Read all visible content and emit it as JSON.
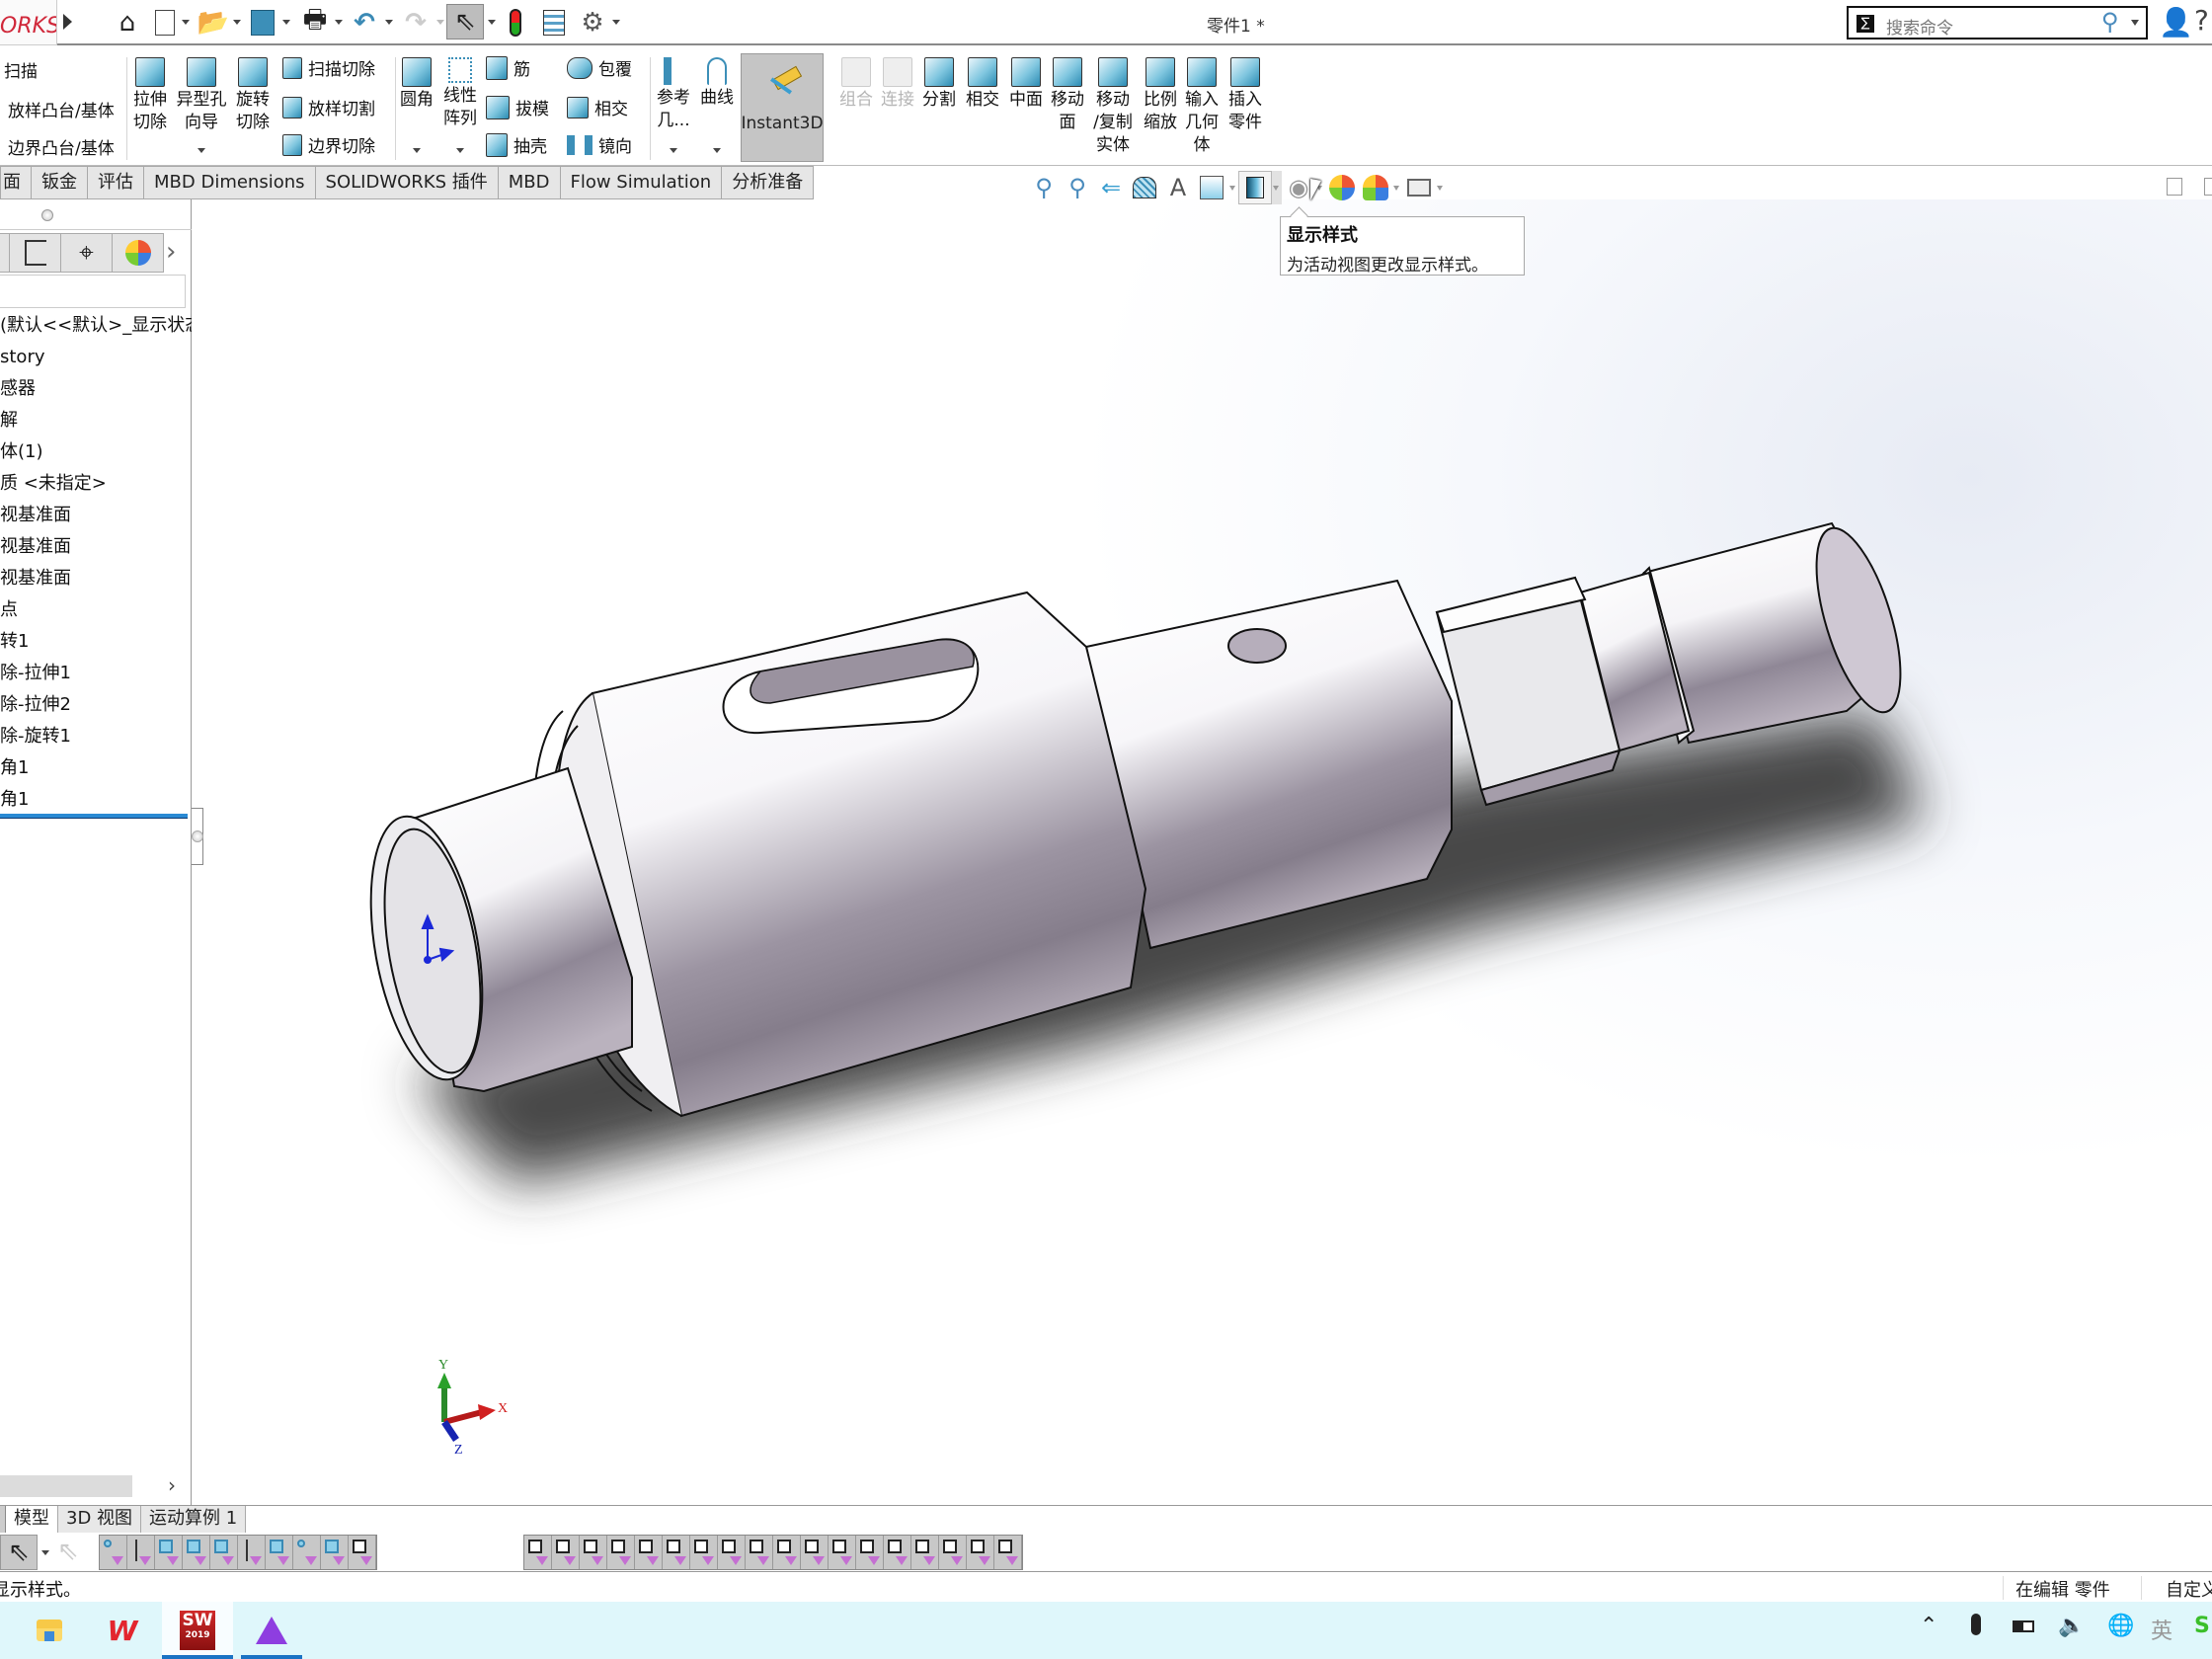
{
  "app": {
    "logo_text": "ORKS",
    "document_title": "零件1 *",
    "search": {
      "placeholder": "搜索命令"
    }
  },
  "quick_access": [
    {
      "name": "home",
      "icon": "home-icon"
    },
    {
      "name": "new",
      "icon": "new-document-icon"
    },
    {
      "name": "open",
      "icon": "open-folder-icon"
    },
    {
      "name": "save",
      "icon": "save-icon"
    },
    {
      "name": "print",
      "icon": "print-icon"
    },
    {
      "name": "undo",
      "icon": "undo-icon"
    },
    {
      "name": "redo",
      "icon": "redo-icon"
    },
    {
      "name": "select",
      "icon": "select-arrow-icon"
    },
    {
      "name": "rebuild",
      "icon": "traffic-light-icon"
    },
    {
      "name": "file-properties",
      "icon": "file-properties-icon"
    },
    {
      "name": "options",
      "icon": "gear-icon"
    }
  ],
  "ribbon": {
    "boss_small": [
      "扫描",
      "放样凸台/基体",
      "边界凸台/基体"
    ],
    "cut_big": [
      {
        "label": "拉伸\n切除"
      },
      {
        "label": "异型孔\n向导"
      },
      {
        "label": "旋转\n切除"
      }
    ],
    "cut_small": [
      "扫描切除",
      "放样切割",
      "边界切除"
    ],
    "features_big": [
      {
        "label": "圆角"
      },
      {
        "label": "线性\n阵列"
      }
    ],
    "features_small_col1": [
      "筋",
      "拔模",
      "抽壳"
    ],
    "features_small_col2": [
      "包覆",
      "相交",
      "镜向"
    ],
    "ref_big": [
      {
        "label": "参考\n几..."
      },
      {
        "label": "曲线"
      }
    ],
    "instant3d": "Instant3D",
    "tools_big": [
      {
        "label": "组合",
        "disabled": true
      },
      {
        "label": "连接",
        "disabled": true
      },
      {
        "label": "分割",
        "disabled": false
      },
      {
        "label": "相交",
        "disabled": false
      },
      {
        "label": "中面",
        "disabled": false
      },
      {
        "label": "移动\n面",
        "disabled": false
      },
      {
        "label": "移动\n/复制\n实体",
        "disabled": false
      },
      {
        "label": "比例\n缩放",
        "disabled": false
      },
      {
        "label": "输入\n几何\n体",
        "disabled": false
      },
      {
        "label": "插入\n零件",
        "disabled": false
      }
    ]
  },
  "command_tabs": [
    "面",
    "钣金",
    "评估",
    "MBD Dimensions",
    "SOLIDWORKS 插件",
    "MBD",
    "Flow Simulation",
    "分析准备"
  ],
  "heads_up_toolbar": [
    {
      "icon": "zoom-to-fit-icon"
    },
    {
      "icon": "zoom-to-area-icon"
    },
    {
      "icon": "previous-view-icon"
    },
    {
      "icon": "section-view-icon"
    },
    {
      "icon": "dynamic-annotation-views-icon"
    },
    {
      "icon": "view-orientation-icon"
    },
    {
      "icon": "display-style-icon",
      "active": true
    },
    {
      "icon": "hide-show-items-icon"
    },
    {
      "icon": "edit-appearance-icon"
    },
    {
      "icon": "apply-scene-icon"
    },
    {
      "icon": "view-settings-icon"
    }
  ],
  "tooltip": {
    "title": "显示样式",
    "body": "为活动视图更改显示样式。"
  },
  "feature_manager": {
    "tabs": [
      "featuremanager-tree-icon",
      "configuration-manager-icon",
      "dimxpert-manager-icon",
      "display-manager-icon"
    ],
    "tree": [
      "(默认<<默认>_显示状态",
      "story",
      "感器",
      "解",
      "体(1)",
      "质 <未指定>",
      "视基准面",
      "视基准面",
      "视基准面",
      "点",
      "转1",
      "除-拉伸1",
      "除-拉伸2",
      "除-旋转1",
      "角1",
      "角1"
    ]
  },
  "bottom_tabs": [
    "模型",
    "3D 视图",
    "运动算例 1"
  ],
  "active_bottom_tab": "模型",
  "triad": {
    "x": "X",
    "y": "Y",
    "z": "Z"
  },
  "status": {
    "message": "显示样式。",
    "edit_mode": "在编辑 零件",
    "units": "自定义"
  },
  "taskbar": {
    "apps": [
      {
        "name": "file-explorer",
        "active": false
      },
      {
        "name": "wps-office",
        "label": "W",
        "active": false
      },
      {
        "name": "solidworks-2019",
        "label": "SW",
        "sub": "2019",
        "active": true
      },
      {
        "name": "ai-app",
        "active": true
      }
    ],
    "tray": [
      "chevron-up-icon",
      "microphone-icon",
      "battery-icon",
      "volume-icon",
      "network-icon",
      "ime-icon",
      "sogou-icon"
    ],
    "ime_label": "英"
  }
}
